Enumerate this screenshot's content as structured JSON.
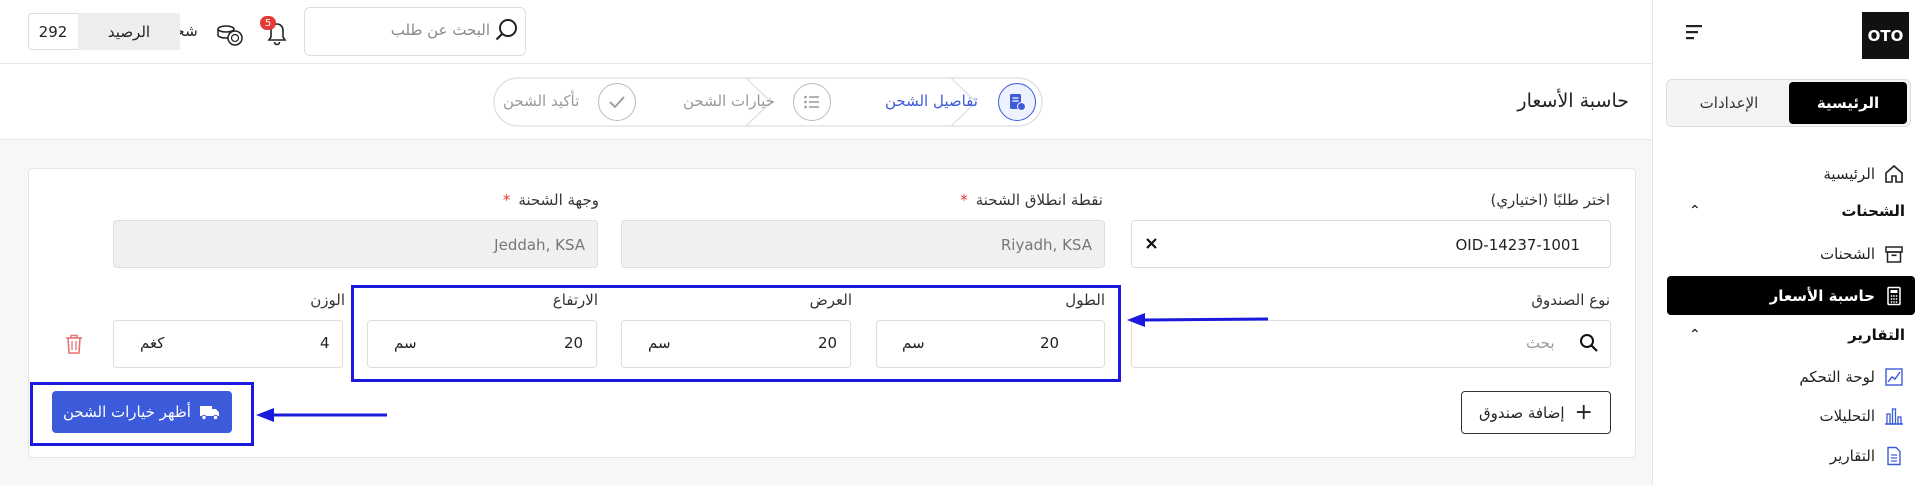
{
  "sidebar": {
    "logo": "OTO",
    "tabs": {
      "home": "الرئيسية",
      "settings": "الإعدادات"
    },
    "items": {
      "home": "الرئيسية",
      "shipments_section": "الشحنات",
      "shipments": "الشحنات",
      "rate_calculator": "حاسبة الأسعار",
      "reports_section": "التقارير",
      "dashboard": "لوحة التحكم",
      "analytics": "التحليلات",
      "reports": "التقارير"
    }
  },
  "topbar": {
    "search_placeholder": "البحث عن طلب",
    "notifications_count": "5",
    "ship_label": "شحن",
    "balance_label": "الرصيد",
    "balance_value": "292"
  },
  "page": {
    "title": "حاسبة الأسعار",
    "steps": [
      "تفاصيل الشحن",
      "خيارات الشحن",
      "تأكيد الشحن"
    ]
  },
  "form": {
    "order_label": "اختر طلبًا (اختياري)",
    "order_value": "OID-14237-1001",
    "origin_label": "نقطة انطلاق الشحنة",
    "origin_value": "Riyadh, KSA",
    "destination_label": "وجهة الشحنة",
    "destination_value": "Jeddah, KSA",
    "required_mark": "*",
    "box_type_label": "نوع الصندوق",
    "box_search_placeholder": "بحث",
    "length_label": "الطول",
    "length_value": "20",
    "width_label": "العرض",
    "width_value": "20",
    "height_label": "الارتفاع",
    "height_value": "20",
    "dim_unit": "سم",
    "weight_label": "الوزن",
    "weight_value": "4",
    "weight_unit": "كغم",
    "add_box": "إضافة صندوق",
    "show_options": "أظهر خيارات الشحن"
  },
  "colors": {
    "accent": "#3b5bdb",
    "annotation": "#1a1adf",
    "danger": "#e53935"
  }
}
